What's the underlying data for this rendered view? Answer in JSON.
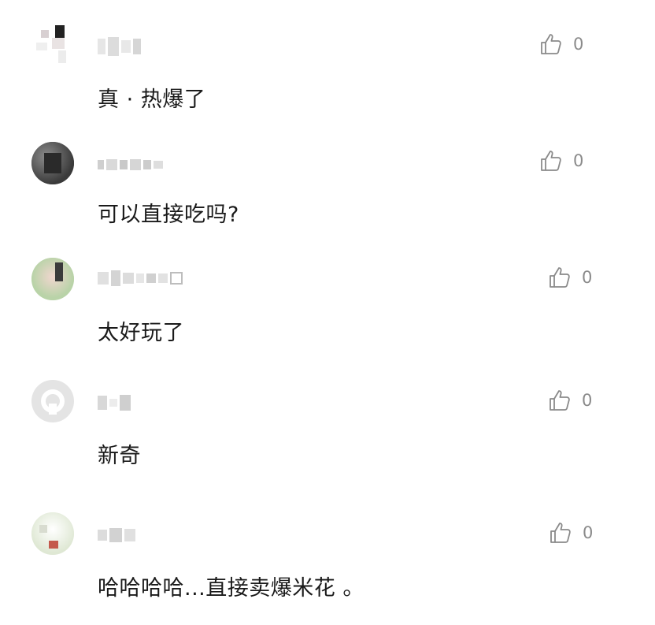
{
  "comments": [
    {
      "avatar_icon": "avatar",
      "username": "",
      "likes": "0",
      "text": "真 · 热爆了"
    },
    {
      "avatar_icon": "avatar",
      "username": "",
      "likes": "0",
      "text": "可以直接吃吗?"
    },
    {
      "avatar_icon": "avatar",
      "username": "",
      "likes": "0",
      "text": "太好玩了"
    },
    {
      "avatar_icon": "avatar",
      "username": "",
      "likes": "0",
      "text": "新奇"
    },
    {
      "avatar_icon": "avatar",
      "username": "",
      "likes": "0",
      "text": "哈哈哈哈...直接卖爆米花 。"
    }
  ],
  "colors": {
    "text": "#1a1a1a",
    "meta": "#8a8a8a",
    "background": "#ffffff"
  },
  "icons": {
    "like": "thumbs-up-icon"
  }
}
